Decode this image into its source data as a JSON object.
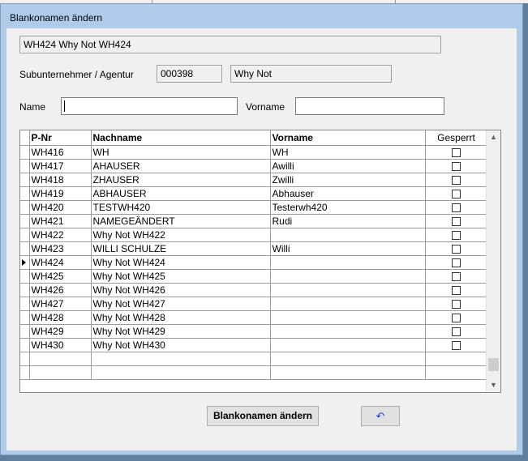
{
  "window": {
    "title": "Blankonamen ändern"
  },
  "header": {
    "record": "WH424 Why Not WH424",
    "sub_label": "Subunternehmer / Agentur",
    "sub_code": "000398",
    "sub_name": "Why Not",
    "name_label": "Name",
    "name_value": "",
    "vorname_label": "Vorname",
    "vorname_value": ""
  },
  "grid": {
    "columns": [
      "P-Nr",
      "Nachname",
      "Vorname",
      "Gesperrt"
    ],
    "rows": [
      {
        "pnr": "WH416",
        "nachname": "WH",
        "vorname": "WH",
        "gesperrt": false
      },
      {
        "pnr": "WH417",
        "nachname": "AHAUSER",
        "vorname": "Awilli",
        "gesperrt": false
      },
      {
        "pnr": "WH418",
        "nachname": "ZHAUSER",
        "vorname": "Zwilli",
        "gesperrt": false
      },
      {
        "pnr": "WH419",
        "nachname": "ABHAUSER",
        "vorname": "Abhauser",
        "gesperrt": false
      },
      {
        "pnr": "WH420",
        "nachname": "TESTWH420",
        "vorname": "Testerwh420",
        "gesperrt": false
      },
      {
        "pnr": "WH421",
        "nachname": "NAMEGEÄNDERT",
        "vorname": "Rudi",
        "gesperrt": false
      },
      {
        "pnr": "WH422",
        "nachname": "Why Not WH422",
        "vorname": "",
        "gesperrt": false
      },
      {
        "pnr": "WH423",
        "nachname": "WILLI SCHULZE",
        "vorname": "Willi",
        "gesperrt": false
      },
      {
        "pnr": "WH424",
        "nachname": "Why Not WH424",
        "vorname": "",
        "gesperrt": false,
        "current": true
      },
      {
        "pnr": "WH425",
        "nachname": "Why Not WH425",
        "vorname": "",
        "gesperrt": false
      },
      {
        "pnr": "WH426",
        "nachname": "Why Not WH426",
        "vorname": "",
        "gesperrt": false
      },
      {
        "pnr": "WH427",
        "nachname": "Why Not WH427",
        "vorname": "",
        "gesperrt": false
      },
      {
        "pnr": "WH428",
        "nachname": "Why Not WH428",
        "vorname": "",
        "gesperrt": false
      },
      {
        "pnr": "WH429",
        "nachname": "Why Not WH429",
        "vorname": "",
        "gesperrt": false
      },
      {
        "pnr": "WH430",
        "nachname": "Why Not WH430",
        "vorname": "",
        "gesperrt": false
      }
    ],
    "empty_rows": 2
  },
  "buttons": {
    "submit": "Blankonamen ändern",
    "undo_icon": "undo-icon"
  },
  "colors": {
    "window_frame": "#aecbea",
    "client_bg": "#f0f0f0",
    "undo_accent": "#1f3fbf"
  }
}
